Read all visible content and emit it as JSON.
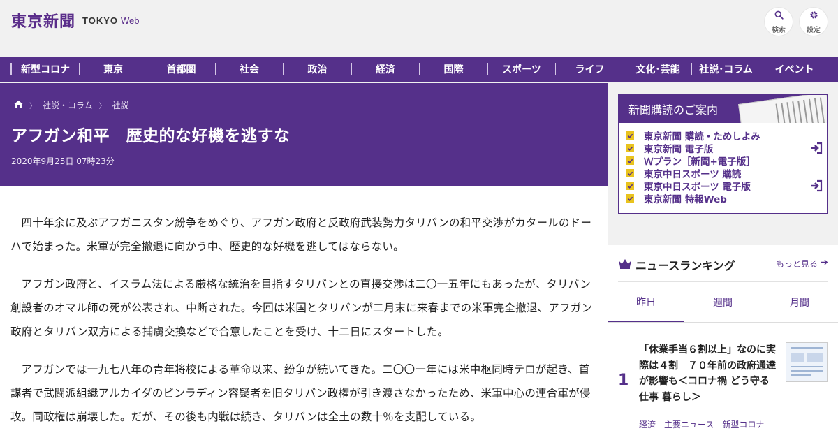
{
  "header": {
    "logo_jp": "東京新聞",
    "logo_tokyo": "TOKYO",
    "logo_web": "Web",
    "search_label": "検索",
    "settings_label": "設定"
  },
  "nav": {
    "items": [
      {
        "label": "新型コロナ"
      },
      {
        "label": "東京"
      },
      {
        "label": "首都圏"
      },
      {
        "label": "社会"
      },
      {
        "label": "政治"
      },
      {
        "label": "経済"
      },
      {
        "label": "国際"
      },
      {
        "label": "スポーツ"
      },
      {
        "label": "ライフ"
      },
      {
        "label": "文化･芸能"
      },
      {
        "label": "社説･コラム"
      },
      {
        "label": "イベント"
      }
    ]
  },
  "breadcrumb": {
    "home_icon": "home-icon",
    "items": [
      "社説・コラム",
      "社説"
    ]
  },
  "article": {
    "title": "アフガン和平　歴史的な好機を逃すな",
    "date": "2020年9月25日 07時23分",
    "paragraphs": [
      "四十年余に及ぶアフガニスタン紛争をめぐり、アフガン政府と反政府武装勢力タリバンの和平交渉がカタールのドーハで始まった。米軍が完全撤退に向かう中、歴史的な好機を逃してはならない。",
      "アフガン政府と、イスラム法による厳格な統治を目指すタリバンとの直接交渉は二〇一五年にもあったが、タリバン創設者のオマル師の死が公表され、中断された。今回は米国とタリバンが二月末に来春までの米軍完全撤退、アフガン政府とタリバン双方による捕虜交換などで合意したことを受け、十二日にスタートした。",
      "アフガンでは一九七八年の青年将校による革命以来、紛争が続いてきた。二〇〇一年には米中枢同時テロが起き、首謀者で武闘派組織アルカイダのビンラディン容疑者を旧タリバン政権が引き渡さなかったため、米軍中心の連合軍が侵攻。同政権は崩壊した。だが、その後も内戦は続き、タリバンは全土の数十％を支配している。"
    ]
  },
  "subscription": {
    "title": "新聞購読のご案内",
    "items": [
      {
        "label": "東京新聞 購読・ためしよみ",
        "login": false
      },
      {
        "label": "東京新聞 電子版",
        "login": true
      },
      {
        "label": "Ｗプラン［新聞+電子版］",
        "login": false
      },
      {
        "label": "東京中日スポーツ 購読",
        "login": false
      },
      {
        "label": "東京中日スポーツ 電子版",
        "login": true
      },
      {
        "label": "東京新聞 特報Web",
        "login": false
      }
    ]
  },
  "ranking": {
    "title": "ニュースランキング",
    "more": "もっと見る",
    "tabs": [
      "昨日",
      "週間",
      "月間"
    ],
    "active_tab": "昨日",
    "items": [
      {
        "rank": "1",
        "title": "「休業手当６割以上」なのに実際は４割　７０年前の政府通達が影響も＜コロナ禍 どう守る 仕事 暮らし＞",
        "tags": [
          "経済",
          "主要ニュース",
          "新型コロナ"
        ]
      }
    ]
  },
  "colors": {
    "brand_purple": "#55308a",
    "check_yellow": "#e9c31e",
    "background": "#f1f1f1"
  }
}
